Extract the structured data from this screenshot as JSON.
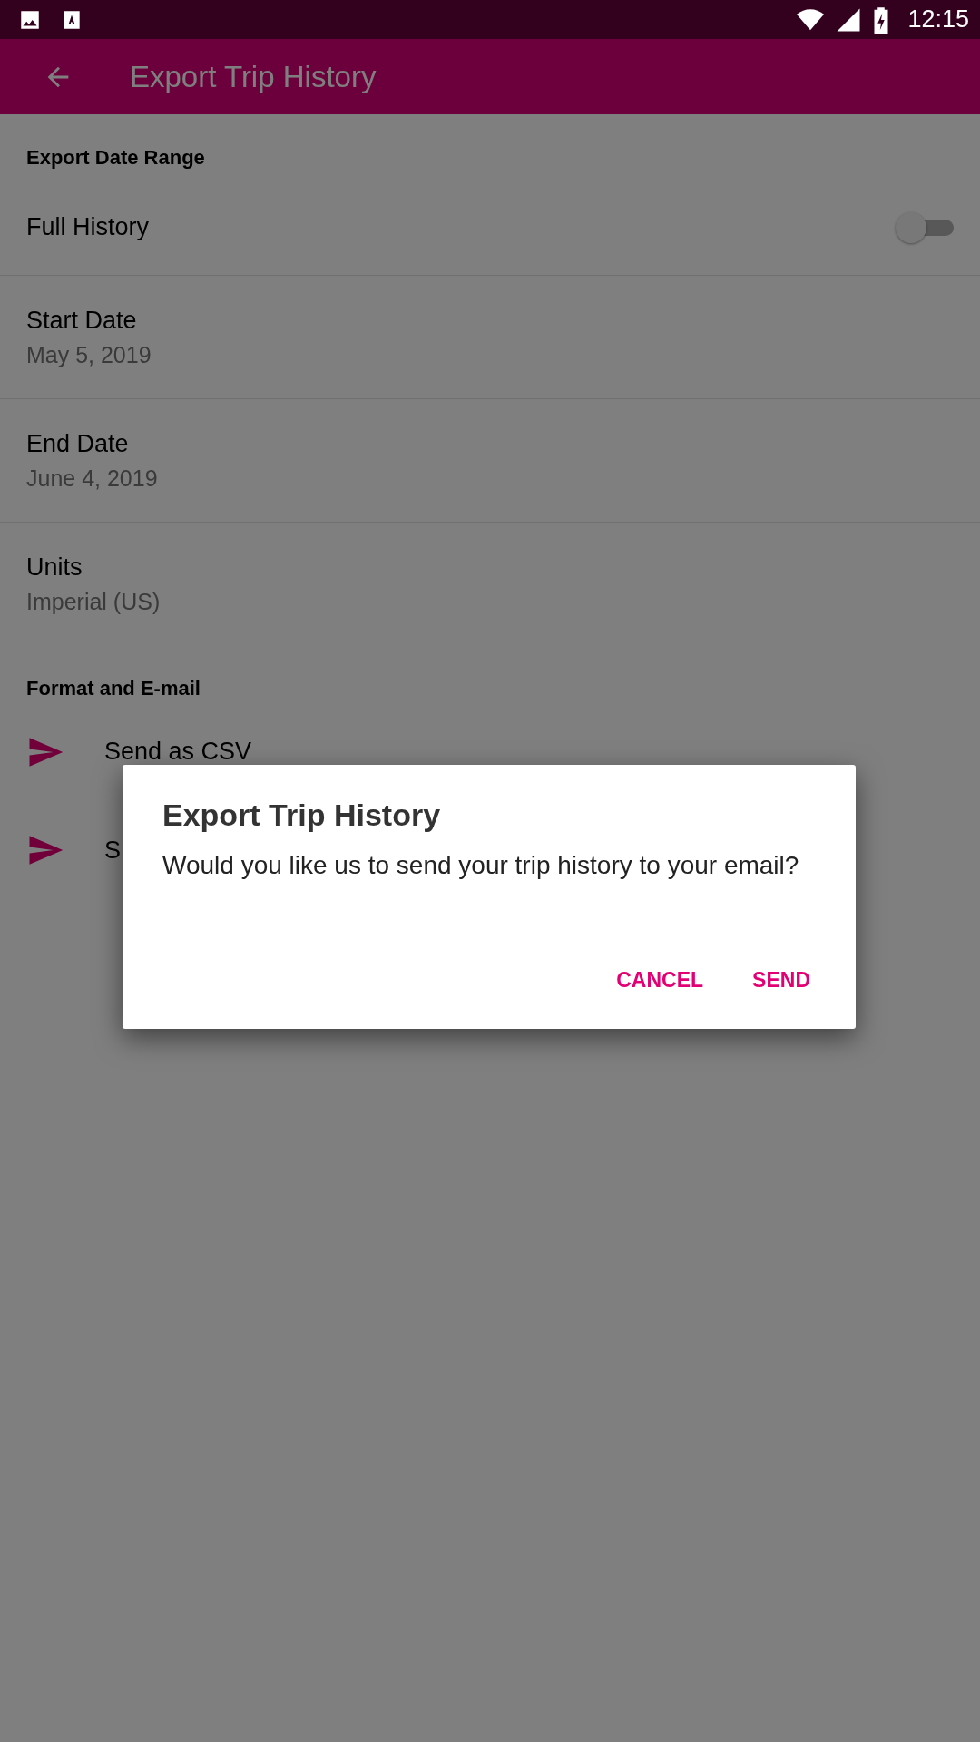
{
  "status_bar": {
    "time": "12:15"
  },
  "app_bar": {
    "title": "Export Trip History"
  },
  "sections": [
    {
      "header": "Export Date Range",
      "items": [
        {
          "kind": "toggle",
          "label": "Full History",
          "on": false
        },
        {
          "kind": "value",
          "label": "Start Date",
          "value": "May 5, 2019"
        },
        {
          "kind": "value",
          "label": "End Date",
          "value": "June 4, 2019"
        },
        {
          "kind": "value",
          "label": "Units",
          "value": "Imperial (US)"
        }
      ]
    },
    {
      "header": "Format and E-mail",
      "items": [
        {
          "kind": "action",
          "label": "Send as CSV"
        },
        {
          "kind": "action",
          "label": "S"
        }
      ]
    }
  ],
  "dialog": {
    "title": "Export Trip History",
    "message": "Would you like us to send your trip history to your email?",
    "buttons": [
      "CANCEL",
      "SEND"
    ]
  }
}
